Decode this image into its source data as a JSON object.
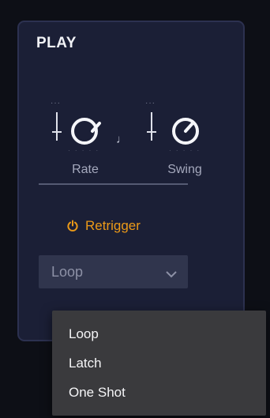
{
  "panel": {
    "title": "PLAY"
  },
  "knobs": [
    {
      "label": "Rate",
      "dots": "···"
    },
    {
      "label": "Swing",
      "dots": "···"
    }
  ],
  "note_symbol": "♩",
  "retrigger": {
    "label": "Retrigger",
    "icon": "power-icon",
    "color": "#ec9a18"
  },
  "dropdown": {
    "value": "Loop",
    "icon": "chevron-down-icon"
  },
  "menu": {
    "items": [
      {
        "label": "Loop"
      },
      {
        "label": "Latch"
      },
      {
        "label": "One Shot"
      }
    ]
  },
  "colors": {
    "panel_bg": "#1b1f36",
    "panel_border": "#2c3150",
    "accent": "#ec9a18",
    "menu_bg": "#3a3a3d"
  }
}
